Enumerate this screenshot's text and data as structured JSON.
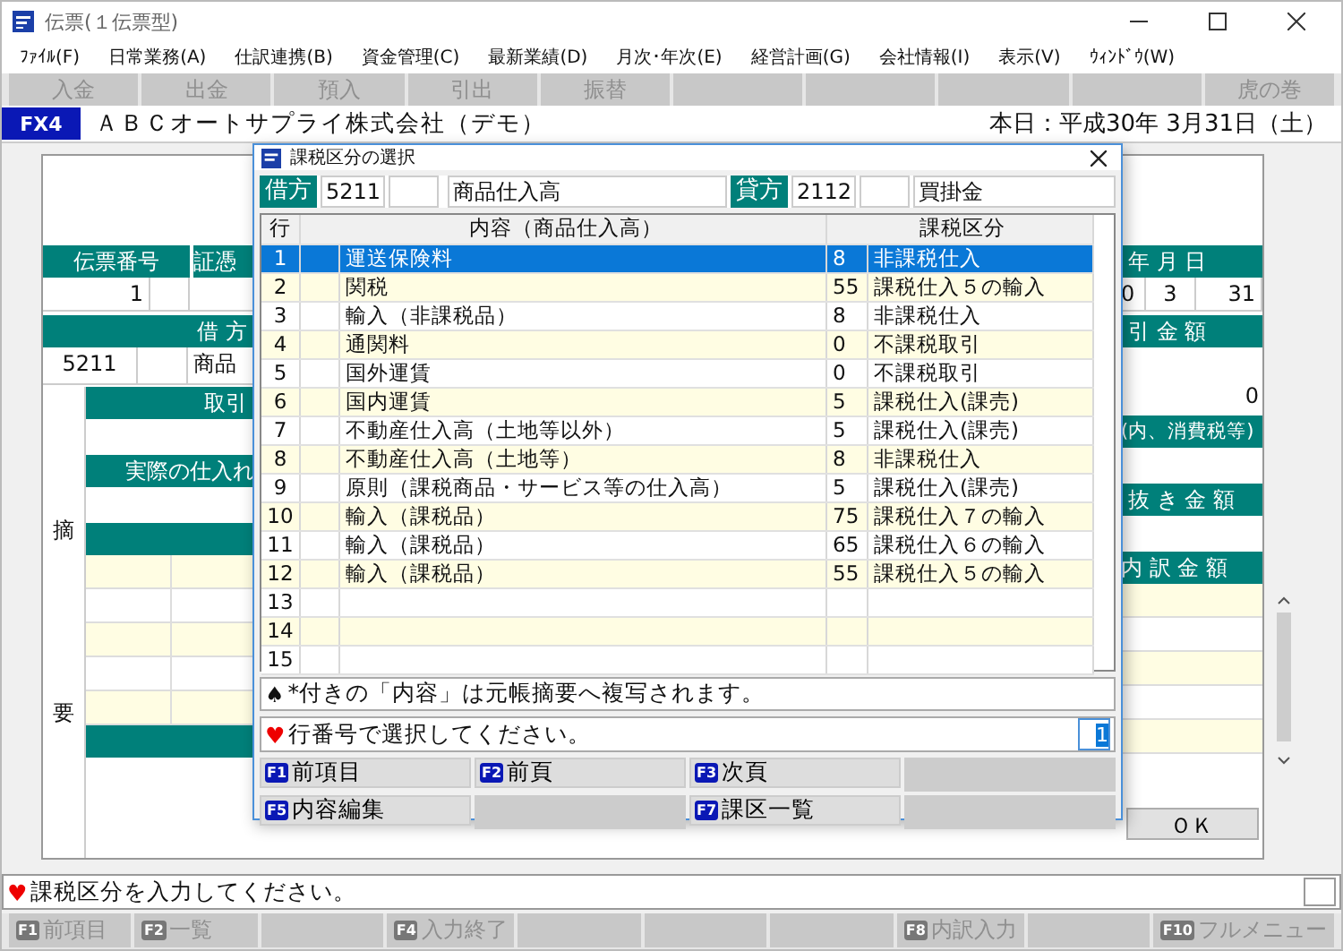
{
  "window": {
    "title": "伝票(１伝票型)"
  },
  "menu": [
    "ﾌｧｲﾙ(F)",
    "日常業務(A)",
    "仕訳連携(B)",
    "資金管理(C)",
    "最新業績(D)",
    "月次･年次(E)",
    "経営計画(G)",
    "会社情報(I)",
    "表示(V)",
    "ｳｨﾝﾄﾞｳ(W)"
  ],
  "toolbar": [
    {
      "kind": "button",
      "label": "入金",
      "disabled": true
    },
    {
      "kind": "button",
      "label": "出金",
      "disabled": true
    },
    {
      "kind": "button",
      "label": "預入",
      "disabled": true
    },
    {
      "kind": "button",
      "label": "引出",
      "disabled": true
    },
    {
      "kind": "button",
      "label": "振替",
      "disabled": true
    },
    {
      "kind": "blank"
    },
    {
      "kind": "blank"
    },
    {
      "kind": "blank"
    },
    {
      "kind": "blank"
    },
    {
      "kind": "button",
      "label": "虎の巻",
      "disabled": true
    }
  ],
  "company": {
    "badge": "FX4",
    "name": "ＡＢＣオートサプライ株式会社（デモ）",
    "today": "本日：平成30年 3月31日（土）"
  },
  "form": {
    "left": {
      "headers": [
        "伝票番号",
        "証憑"
      ],
      "number": "1",
      "debit_header": "借 方",
      "debit_code": "5211",
      "debit_name": "商品",
      "side_labels": [
        "摘",
        "要"
      ],
      "sections": [
        "取引",
        "実際の仕入れ"
      ]
    },
    "right": {
      "date_header": "年 月 日",
      "date_values": [
        "0",
        "3",
        "31"
      ],
      "amount_header": "引 金 額",
      "amount": "0",
      "tax_header": "(内、消費税等)",
      "net_header": "抜 き 金 額",
      "breakdown_header": "内 訳 金 額"
    },
    "ok_button": "ＯＫ"
  },
  "dialog": {
    "title": "課税区分の選択",
    "debit": {
      "label": "借方",
      "code": "5211",
      "name": "商品仕入高"
    },
    "credit": {
      "label": "貸方",
      "code": "2112",
      "name": "買掛金"
    },
    "columns": [
      "行",
      "内容（商品仕入高）",
      "課税区分"
    ],
    "rows": [
      {
        "no": "1",
        "content": "運送保険料",
        "code": "8",
        "category": "非課税仕入",
        "selected": true
      },
      {
        "no": "2",
        "content": "関税",
        "code": "55",
        "category": "課税仕入５の輸入",
        "selected": false
      },
      {
        "no": "3",
        "content": "輸入（非課税品）",
        "code": "8",
        "category": "非課税仕入",
        "selected": false
      },
      {
        "no": "4",
        "content": "通関料",
        "code": "0",
        "category": "不課税取引",
        "selected": false
      },
      {
        "no": "5",
        "content": "国外運賃",
        "code": "0",
        "category": "不課税取引",
        "selected": false
      },
      {
        "no": "6",
        "content": "国内運賃",
        "code": "5",
        "category": "課税仕入(課売)",
        "selected": false
      },
      {
        "no": "7",
        "content": "不動産仕入高（土地等以外）",
        "code": "5",
        "category": "課税仕入(課売)",
        "selected": false
      },
      {
        "no": "8",
        "content": "不動産仕入高（土地等）",
        "code": "8",
        "category": "非課税仕入",
        "selected": false
      },
      {
        "no": "9",
        "content": "原則（課税商品・サービス等の仕入高）",
        "code": "5",
        "category": "課税仕入(課売)",
        "selected": false
      },
      {
        "no": "10",
        "content": "輸入（課税品）",
        "code": "75",
        "category": "課税仕入７の輸入",
        "selected": false
      },
      {
        "no": "11",
        "content": "輸入（課税品）",
        "code": "65",
        "category": "課税仕入６の輸入",
        "selected": false
      },
      {
        "no": "12",
        "content": "輸入（課税品）",
        "code": "55",
        "category": "課税仕入５の輸入",
        "selected": false
      },
      {
        "no": "13",
        "selected": false
      },
      {
        "no": "14",
        "selected": false
      },
      {
        "no": "15",
        "selected": false
      }
    ],
    "note_icon": "♠",
    "note": "*付きの「内容」は元帳摘要へ複写されます。",
    "prompt_icon": "♥",
    "prompt": "行番号で選択してください。",
    "input_value": "1",
    "fkeys": [
      {
        "kind": "key",
        "key": "F1",
        "label": "前項目"
      },
      {
        "kind": "key",
        "key": "F2",
        "label": "前頁"
      },
      {
        "kind": "key",
        "key": "F3",
        "label": "次頁"
      },
      {
        "kind": "blank"
      },
      {
        "kind": "key",
        "key": "F5",
        "label": "内容編集"
      },
      {
        "kind": "blank"
      },
      {
        "kind": "key",
        "key": "F7",
        "label": "課区一覧"
      },
      {
        "kind": "blank"
      }
    ]
  },
  "status": {
    "icon": "♥",
    "message": "課税区分を入力してください。"
  },
  "fkeys": [
    {
      "kind": "key",
      "key": "F1",
      "label": "前項目",
      "disabled": true
    },
    {
      "kind": "key",
      "key": "F2",
      "label": "一覧",
      "disabled": true
    },
    {
      "kind": "blank"
    },
    {
      "kind": "key",
      "key": "F4",
      "label": "入力終了",
      "disabled": true
    },
    {
      "kind": "blank"
    },
    {
      "kind": "blank"
    },
    {
      "kind": "blank"
    },
    {
      "kind": "key",
      "key": "F8",
      "label": "内訳入力",
      "disabled": true
    },
    {
      "kind": "blank"
    },
    {
      "kind": "key",
      "key": "F10",
      "label": "フルメニュー",
      "disabled": true
    }
  ]
}
